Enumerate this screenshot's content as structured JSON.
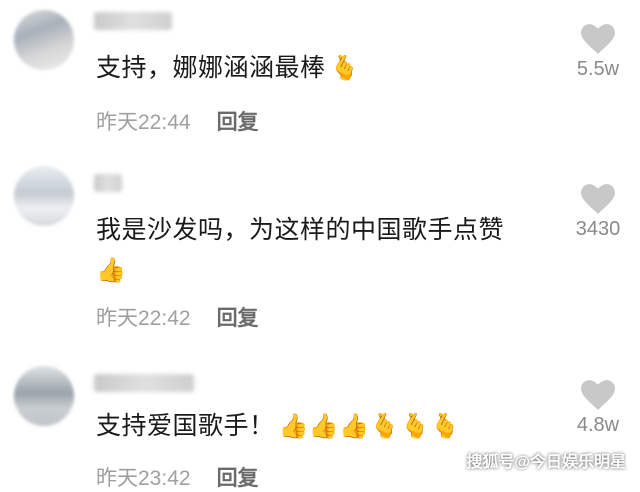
{
  "comments": [
    {
      "username": "",
      "text": "支持，娜娜涵涵最棒",
      "emojis": "🫰",
      "time": "昨天22:44",
      "reply_label": "回复",
      "likes": "5.5w"
    },
    {
      "username": "",
      "text": "我是沙发吗，为这样的中国歌手点赞",
      "emojis": "👍",
      "time": "昨天22:42",
      "reply_label": "回复",
      "likes": "3430"
    },
    {
      "username": "",
      "text": "支持爱国歌手！",
      "emojis": "👍👍👍🫰🫰🫰",
      "time": "昨天23:42",
      "reply_label": "回复",
      "likes": "4.8w"
    }
  ],
  "watermark": "搜狐号@今日娱乐明星",
  "colors": {
    "heart": "#c8c8c8",
    "meta": "#a0a0a0",
    "text": "#1a1a1a"
  }
}
